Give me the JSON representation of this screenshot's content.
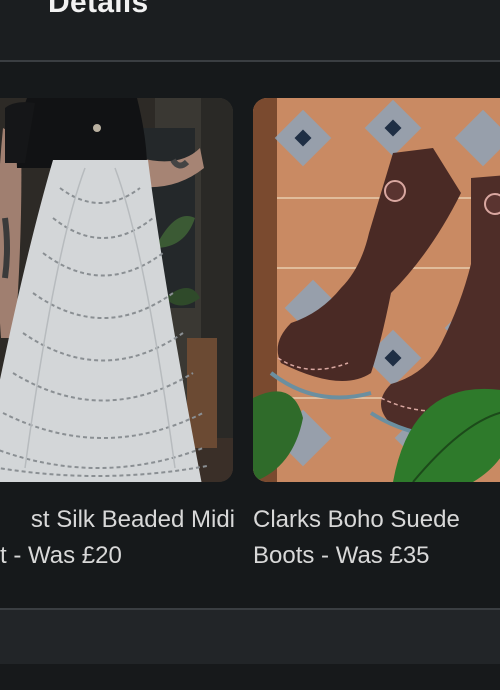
{
  "header": {
    "title": "Details"
  },
  "products": [
    {
      "title_line1": "st Silk Beaded Midi",
      "title_line2": "t - Was £20"
    },
    {
      "title_line1": "Clarks Boho Suede",
      "title_line2": "Boots - Was £35"
    }
  ]
}
